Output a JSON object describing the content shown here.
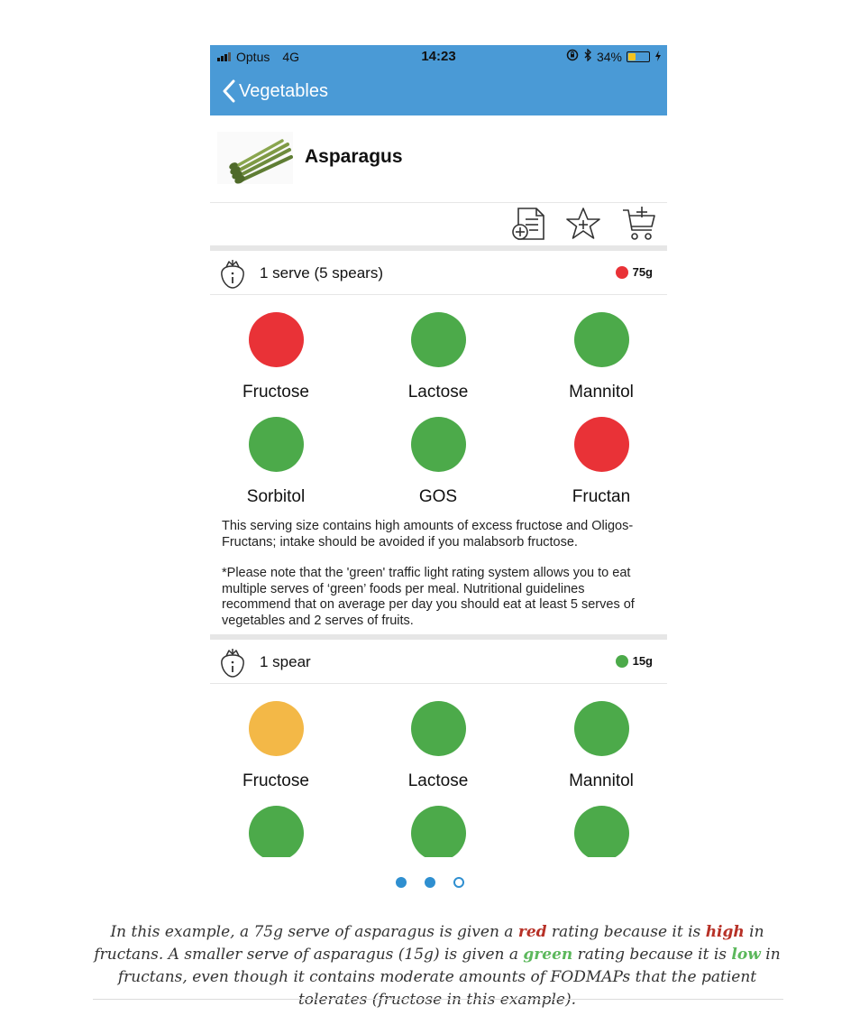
{
  "status_bar": {
    "carrier": "Optus",
    "network": "4G",
    "time": "14:23",
    "battery": "34%",
    "battery_level": 0.34
  },
  "nav": {
    "back_label": "Vegetables"
  },
  "food": {
    "name": "Asparagus",
    "image_icon": "asparagus-image"
  },
  "actions": [
    {
      "icon": "add-to-list-icon"
    },
    {
      "icon": "add-favourite-icon"
    },
    {
      "icon": "add-to-cart-icon"
    }
  ],
  "colors": {
    "red": "#e93237",
    "green": "#4caa4a",
    "amber": "#f3b847",
    "header_blue": "#4a9ad6"
  },
  "serves": [
    {
      "label": "1 serve (5 spears)",
      "weight": "75g",
      "rating": "red",
      "fodmaps": [
        {
          "name": "Fructose",
          "rating": "red"
        },
        {
          "name": "Lactose",
          "rating": "green"
        },
        {
          "name": "Mannitol",
          "rating": "green"
        },
        {
          "name": "Sorbitol",
          "rating": "green"
        },
        {
          "name": "GOS",
          "rating": "green"
        },
        {
          "name": "Fructan",
          "rating": "red"
        }
      ],
      "description": "This serving size contains  high amounts of excess fructose and Oligos-Fructans; intake should be avoided if you malabsorb fructose.",
      "note": "*Please note that the 'green' traffic light rating system allows you to eat multiple serves of ‘green’ foods per meal.  Nutritional guidelines recommend that on average per day you should eat at least 5 serves of vegetables and 2 serves of fruits."
    },
    {
      "label": "1 spear",
      "weight": "15g",
      "rating": "green",
      "fodmaps": [
        {
          "name": "Fructose",
          "rating": "amber"
        },
        {
          "name": "Lactose",
          "rating": "green"
        },
        {
          "name": "Mannitol",
          "rating": "green"
        },
        {
          "name": "",
          "rating": "green"
        },
        {
          "name": "",
          "rating": "green"
        },
        {
          "name": "",
          "rating": "green"
        }
      ]
    }
  ],
  "pager": {
    "pages": 3,
    "current": 2
  },
  "caption": {
    "part1": "In this example, a 75g serve of asparagus is given a ",
    "red_word": "red",
    "part2": " rating because it is ",
    "high_word": "high",
    "part3": " in fructans. A smaller serve of asparagus (15g) is given a ",
    "green_word": "green",
    "part4": " rating because it is ",
    "low_word": "low",
    "part5": " in fructans, even though it contains moderate amounts of FODMAPs that the patient tolerates (fructose in this example).",
    "red_color": "#b73127",
    "green_color": "#5cb85c"
  }
}
